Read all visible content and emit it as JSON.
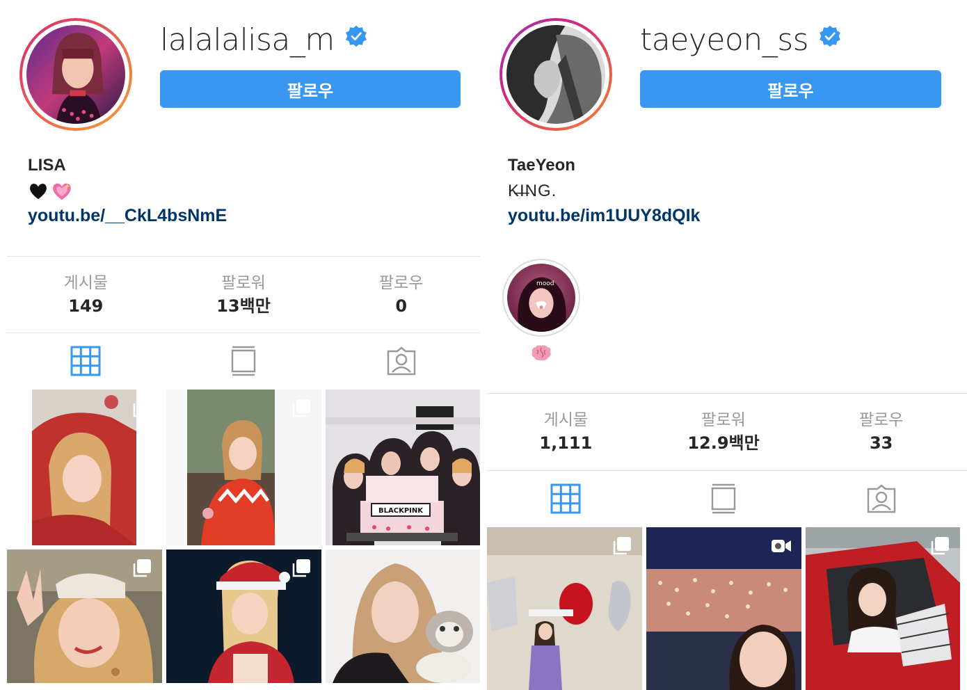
{
  "colors": {
    "follow_button": "#3897f0",
    "link": "#003569",
    "verified": "#3897f0",
    "active_tab": "#3897f0",
    "inactive_tab": "#999999",
    "stat_label": "#999999"
  },
  "profiles": [
    {
      "username": "lalalalisa_m",
      "verified": true,
      "follow_label": "팔로우",
      "full_name": "LISA",
      "bio_emoji": [
        "black-heart",
        "sparkling-pink-heart"
      ],
      "bio_link": "youtu.be/__CkL4bsNmE",
      "stats": [
        {
          "label": "게시물",
          "value": "149"
        },
        {
          "label": "팔로워",
          "value": "13백만"
        },
        {
          "label": "팔로우",
          "value": "0"
        }
      ],
      "tabs": [
        {
          "icon": "grid-icon",
          "active": true
        },
        {
          "icon": "feed-icon",
          "active": false
        },
        {
          "icon": "tagged-icon",
          "active": false
        }
      ],
      "posts": [
        {
          "badge": "multi-photo-icon"
        },
        {
          "badge": "multi-photo-icon"
        },
        {
          "badge": null,
          "caption": "BLACKPINK"
        },
        {
          "badge": "multi-photo-icon"
        },
        {
          "badge": "multi-photo-icon"
        },
        {
          "badge": null
        }
      ]
    },
    {
      "username": "taeyeon_ss",
      "verified": true,
      "follow_label": "팔로우",
      "full_name": "TaeYeon",
      "bio_text": "K̶I̶NG.",
      "bio_link": "youtu.be/im1UUY8dQIk",
      "highlight": {
        "label_emoji": "brain",
        "inner_text": "mood"
      },
      "stats": [
        {
          "label": "게시물",
          "value": "1,111"
        },
        {
          "label": "팔로워",
          "value": "12.9백만"
        },
        {
          "label": "팔로우",
          "value": "33"
        }
      ],
      "tabs": [
        {
          "icon": "grid-icon",
          "active": true
        },
        {
          "icon": "feed-icon",
          "active": false
        },
        {
          "icon": "tagged-icon",
          "active": false
        }
      ],
      "posts": [
        {
          "badge": "multi-photo-icon"
        },
        {
          "badge": "video-icon"
        },
        {
          "badge": "multi-photo-icon"
        }
      ]
    }
  ]
}
